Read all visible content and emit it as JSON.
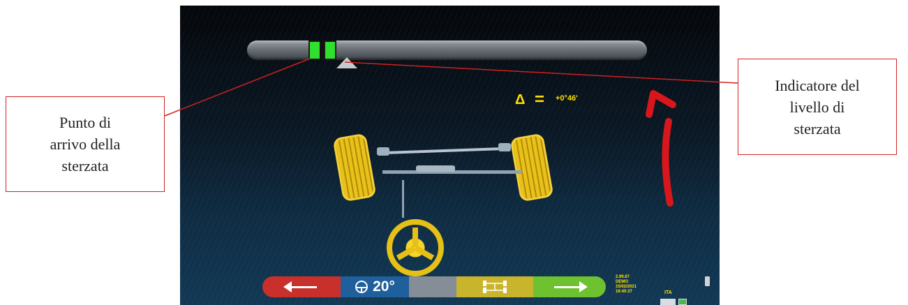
{
  "level_indicator": {
    "current_fraction": 0.25,
    "target_fraction": 0.195
  },
  "delta": {
    "symbol": "Δ",
    "equals": "=",
    "value": "+0°46'"
  },
  "bottom_bar": {
    "steer_angle": "20°",
    "colors": {
      "prev": "#c9302c",
      "angle": "#1f5f9c",
      "blank": "#858d96",
      "car": "#c9b52c",
      "next": "#6ec12f"
    }
  },
  "status": {
    "version": "2.99.67",
    "mode": "DEMO",
    "date": "15/02/2021",
    "time": "16:40:27",
    "language": "ITA"
  },
  "callouts": {
    "left": "Punto di\narrivo della\nsterzata",
    "right": "Indicatore del\nlivello di\nsterzata"
  },
  "icons": [
    "arrow-left-icon",
    "steering-wheel-icon",
    "axle-icon",
    "arrow-right-icon",
    "battery-icon"
  ]
}
